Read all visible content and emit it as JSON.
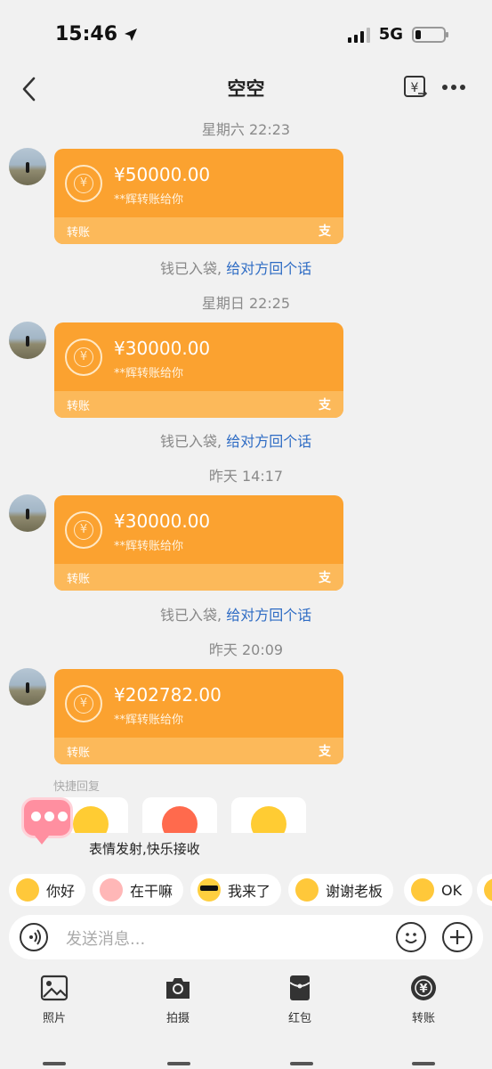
{
  "status": {
    "time": "15:46",
    "network": "5G",
    "battery_level": 0.2
  },
  "header": {
    "title": "空空"
  },
  "messages": [
    {
      "timestamp": "星期六 22:23",
      "amount": "¥50000.00",
      "from": "**辉转账给你",
      "label": "转账",
      "alipay": "支",
      "status": "钱已入袋,",
      "reply": "给对方回个话"
    },
    {
      "timestamp": "星期日 22:25",
      "amount": "¥30000.00",
      "from": "**辉转账给你",
      "label": "转账",
      "alipay": "支",
      "status": "钱已入袋,",
      "reply": "给对方回个话"
    },
    {
      "timestamp": "昨天 14:17",
      "amount": "¥30000.00",
      "from": "**辉转账给你",
      "label": "转账",
      "alipay": "支",
      "status": "钱已入袋,",
      "reply": "给对方回个话"
    },
    {
      "timestamp": "昨天 20:09",
      "amount": "¥202782.00",
      "from": "**辉转账给你",
      "label": "转账",
      "alipay": "支"
    }
  ],
  "quick_reply": {
    "label": "快捷回复",
    "tip": "表情发射,快乐接收"
  },
  "chips": [
    {
      "label": "你好",
      "emoji": "smile-emoji"
    },
    {
      "label": "在干嘛",
      "emoji": "curious-emoji"
    },
    {
      "label": "我来了",
      "emoji": "sunglasses-emoji"
    },
    {
      "label": "谢谢老板",
      "emoji": "thanks-emoji"
    },
    {
      "label": "OK",
      "emoji": "ok-emoji"
    }
  ],
  "input": {
    "placeholder": "发送消息..."
  },
  "toolbar": [
    {
      "label": "照片",
      "icon": "photo-icon"
    },
    {
      "label": "拍摄",
      "icon": "camera-icon"
    },
    {
      "label": "红包",
      "icon": "red-packet-icon"
    },
    {
      "label": "转账",
      "icon": "transfer-icon"
    }
  ],
  "colors": {
    "card": "#fba230",
    "card_bottom": "#fcb95a",
    "reply_link": "#2d6bc4",
    "background": "#f1f1f1"
  }
}
